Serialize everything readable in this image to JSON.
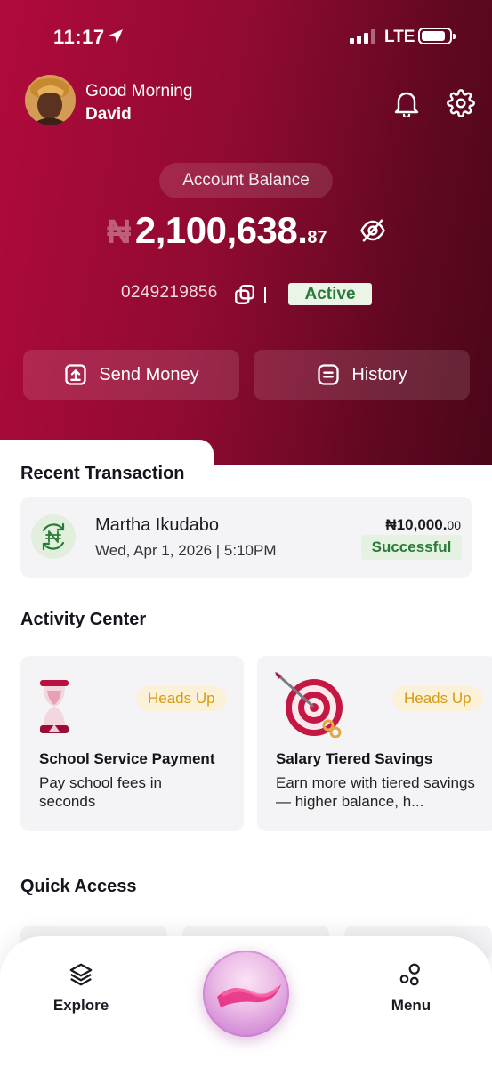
{
  "status_bar": {
    "time": "11:17",
    "network": "LTE"
  },
  "header": {
    "greeting": "Good Morning",
    "user_name": "David"
  },
  "account": {
    "balance_label": "Account Balance",
    "currency_symbol": "₦",
    "balance_main": "2,100,638.",
    "balance_decimal": "87",
    "account_number": "0249219856",
    "status": "Active"
  },
  "actions": {
    "send_money": "Send Money",
    "history": "History"
  },
  "recent_transaction": {
    "title": "Recent Transaction",
    "item": {
      "name": "Martha Ikudabo",
      "date": "Wed, Apr 1, 2026 | 5:10PM",
      "amount_main": "₦10,000.",
      "amount_decimal": "00",
      "status": "Successful"
    }
  },
  "activity_center": {
    "title": "Activity Center",
    "cards": [
      {
        "badge": "Heads Up",
        "title": "School Service Payment",
        "description": "Pay school fees in seconds"
      },
      {
        "badge": "Heads Up",
        "title": "Salary Tiered Savings",
        "description": "Earn more with tiered savings — higher balance, h..."
      }
    ]
  },
  "quick_access": {
    "title": "Quick Access"
  },
  "bottom_nav": {
    "explore": "Explore",
    "menu": "Menu"
  },
  "colors": {
    "brand_primary": "#b10a3c",
    "brand_dark": "#4a0618",
    "success": "#2a7a3a",
    "warning": "#d79a10"
  },
  "icons": [
    "location-arrow-icon",
    "signal-icon",
    "battery-icon",
    "bell-icon",
    "gear-icon",
    "eye-off-icon",
    "copy-icon",
    "upload-icon",
    "history-icon",
    "naira-exchange-icon",
    "hourglass-icon",
    "target-icon",
    "layers-icon",
    "menu-dots-icon"
  ]
}
